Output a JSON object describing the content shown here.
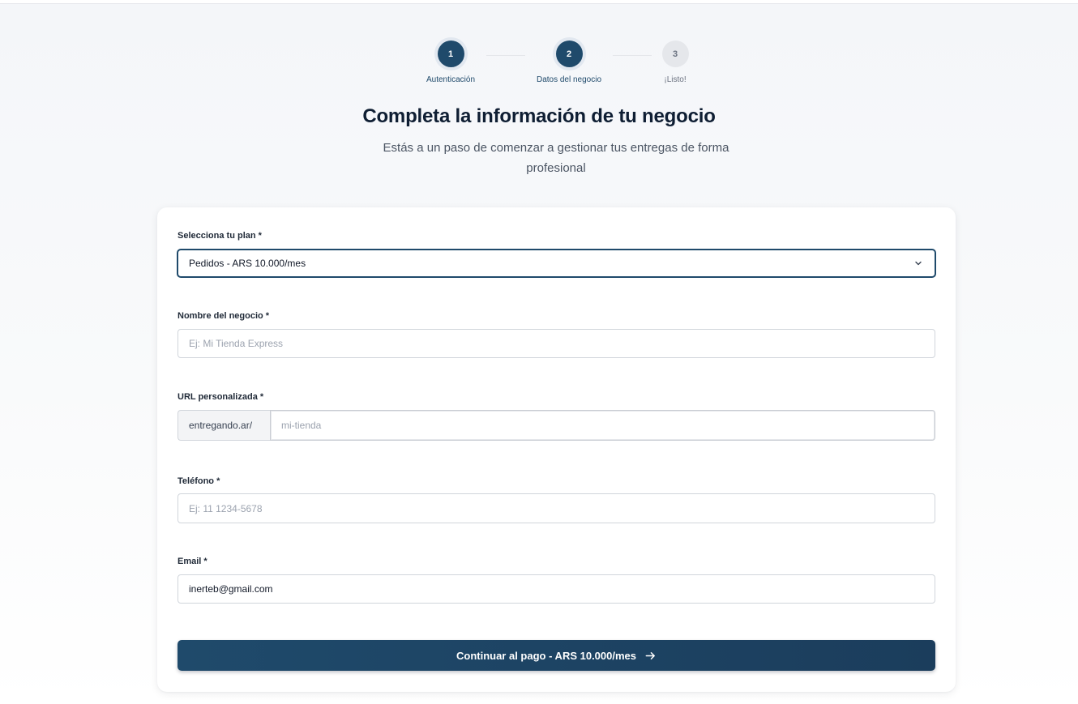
{
  "stepper": {
    "steps": [
      {
        "number": "1",
        "label": "Autenticación",
        "state": "complete"
      },
      {
        "number": "2",
        "label": "Datos del negocio",
        "state": "current"
      },
      {
        "number": "3",
        "label": "¡Listo!",
        "state": "pending"
      }
    ]
  },
  "header": {
    "title": "Completa la información de tu negocio",
    "subtitle": "Estás a un paso de comenzar a gestionar tus entregas de forma profesional"
  },
  "form": {
    "plan": {
      "label": "Selecciona tu plan *",
      "value": "Pedidos - ARS 10.000/mes",
      "icon": "chevron-down-icon"
    },
    "business_name": {
      "label": "Nombre del negocio *",
      "value": "",
      "placeholder": "Ej: Mi Tienda Express"
    },
    "custom_url": {
      "label": "URL personalizada *",
      "prefix": "entregando.ar/",
      "value": "",
      "placeholder": "mi-tienda"
    },
    "phone": {
      "label": "Teléfono *",
      "value": "",
      "placeholder": "Ej: 11 1234-5678"
    },
    "email": {
      "label": "Email *",
      "value": "inerteb@gmail.com",
      "placeholder": ""
    },
    "submit": {
      "label": "Continuar al pago - ARS 10.000/mes",
      "icon": "arrow-right-icon"
    }
  },
  "colors": {
    "primary": "#1f4a6b",
    "step_pending": "#e5e7eb",
    "text_dark": "#0f1e33",
    "text_muted": "#4b5563"
  }
}
